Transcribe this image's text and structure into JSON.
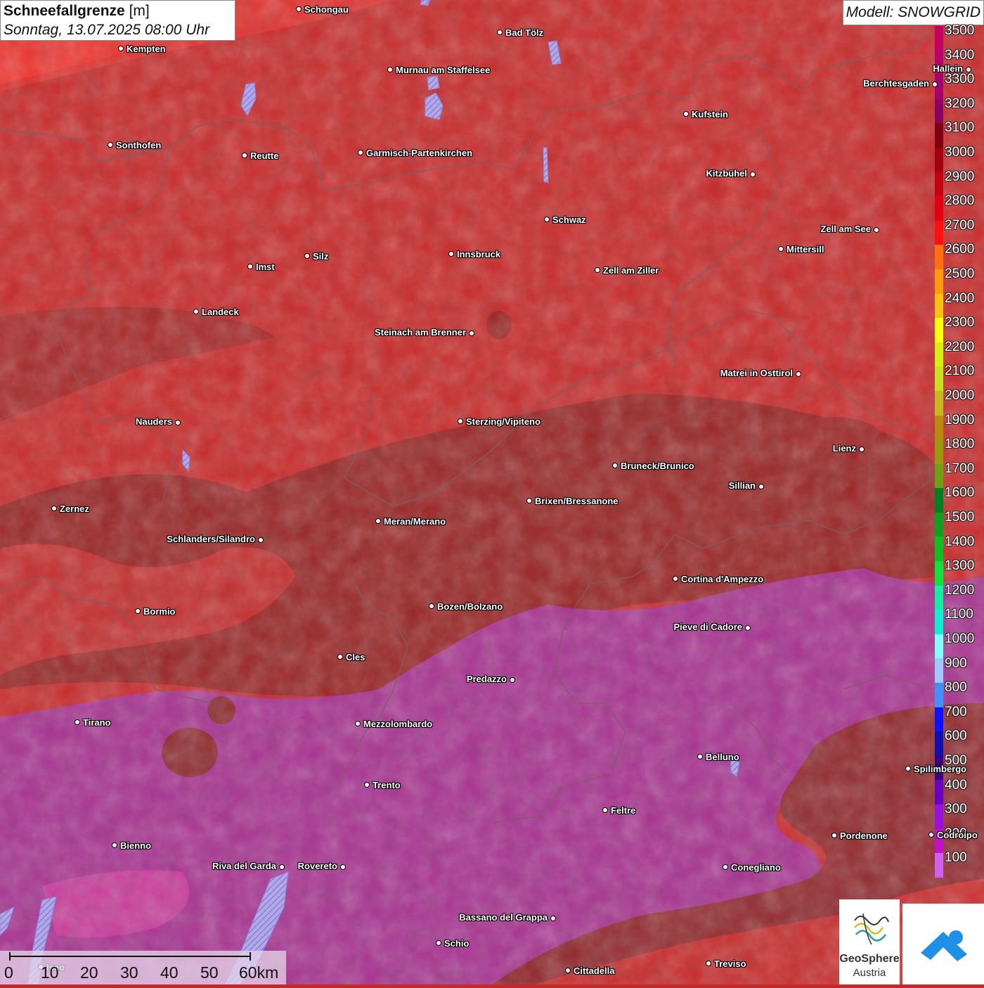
{
  "header": {
    "title_bold": "Schneefallgrenze",
    "title_unit": "[m]",
    "subtitle": "Sonntag, 13.07.2025 08:00 Uhr",
    "model": "Modell: SNOWGRID"
  },
  "legend": {
    "items": [
      {
        "label": "3500",
        "color": "#c4005e"
      },
      {
        "label": "3400",
        "color": "#b8006a"
      },
      {
        "label": "3300",
        "color": "#a3006e"
      },
      {
        "label": "3200",
        "color": "#8a0060"
      },
      {
        "label": "3100",
        "color": "#7a0010"
      },
      {
        "label": "3000",
        "color": "#a00010"
      },
      {
        "label": "2900",
        "color": "#c40010"
      },
      {
        "label": "2800",
        "color": "#e00010"
      },
      {
        "label": "2700",
        "color": "#ff1010"
      },
      {
        "label": "2600",
        "color": "#ff7010"
      },
      {
        "label": "2500",
        "color": "#ff9a10"
      },
      {
        "label": "2400",
        "color": "#ffc010"
      },
      {
        "label": "2300",
        "color": "#ffff10"
      },
      {
        "label": "2200",
        "color": "#d4f010"
      },
      {
        "label": "2100",
        "color": "#c8e020"
      },
      {
        "label": "2000",
        "color": "#c8b820"
      },
      {
        "label": "1900",
        "color": "#b88a10"
      },
      {
        "label": "1800",
        "color": "#9a9a10"
      },
      {
        "label": "1700",
        "color": "#70a010"
      },
      {
        "label": "1600",
        "color": "#008020"
      },
      {
        "label": "1500",
        "color": "#10a020"
      },
      {
        "label": "1400",
        "color": "#10c020"
      },
      {
        "label": "1300",
        "color": "#10e040"
      },
      {
        "label": "1200",
        "color": "#10f0a0"
      },
      {
        "label": "1100",
        "color": "#10f0d0"
      },
      {
        "label": "1000",
        "color": "#80ffff"
      },
      {
        "label": "900",
        "color": "#a0c8ff"
      },
      {
        "label": "800",
        "color": "#4090ff"
      },
      {
        "label": "700",
        "color": "#1010ff"
      },
      {
        "label": "600",
        "color": "#1010b0"
      },
      {
        "label": "500",
        "color": "#3a0080"
      },
      {
        "label": "400",
        "color": "#6a00c0"
      },
      {
        "label": "300",
        "color": "#9a10e0"
      },
      {
        "label": "200",
        "color": "#c010d0"
      },
      {
        "label": "100",
        "color": "#d060f0"
      }
    ]
  },
  "cities": [
    {
      "name": "Schongau",
      "side": "r"
    },
    {
      "name": "Bad Tölz",
      "side": "r"
    },
    {
      "name": "Kempten",
      "side": "r"
    },
    {
      "name": "Murnau am Staffelsee",
      "side": "r"
    },
    {
      "name": "Berchtesgaden",
      "side": "l"
    },
    {
      "name": "Kufstein",
      "side": "r"
    },
    {
      "name": "Sonthofen",
      "side": "r"
    },
    {
      "name": "Reutte",
      "side": "r"
    },
    {
      "name": "Garmisch-Partenkirchen",
      "side": "r"
    },
    {
      "name": "Kitzbühel",
      "side": "l"
    },
    {
      "name": "Schwaz",
      "side": "r"
    },
    {
      "name": "Zell am See",
      "side": "l"
    },
    {
      "name": "Mittersill",
      "side": "r"
    },
    {
      "name": "Innsbruck",
      "side": "r"
    },
    {
      "name": "Silz",
      "side": "r"
    },
    {
      "name": "Imst",
      "side": "r"
    },
    {
      "name": "Zell am Ziller",
      "side": "r"
    },
    {
      "name": "Landeck",
      "side": "r"
    },
    {
      "name": "Steinach am Brenner",
      "side": "l"
    },
    {
      "name": "Matrei in Osttirol",
      "side": "l"
    },
    {
      "name": "Nauders",
      "side": "l"
    },
    {
      "name": "Sterzing/Vipiteno",
      "side": "r"
    },
    {
      "name": "Lienz",
      "side": "l"
    },
    {
      "name": "Bruneck/Brunico",
      "side": "r"
    },
    {
      "name": "Sillian",
      "side": "l"
    },
    {
      "name": "Zernez",
      "side": "r"
    },
    {
      "name": "Brixen/Bressanone",
      "side": "r"
    },
    {
      "name": "Meran/Merano",
      "side": "r"
    },
    {
      "name": "Schlanders/Silandro",
      "side": "l"
    },
    {
      "name": "Cortina d'Ampezzo",
      "side": "r"
    },
    {
      "name": "Bormio",
      "side": "r"
    },
    {
      "name": "Bozen/Bolzano",
      "side": "r"
    },
    {
      "name": "Pieve di Cadore",
      "side": "l"
    },
    {
      "name": "Cles",
      "side": "r"
    },
    {
      "name": "Predazzo",
      "side": "l"
    },
    {
      "name": "Tirano",
      "side": "r"
    },
    {
      "name": "Mezzolombardo",
      "side": "r"
    },
    {
      "name": "Belluno",
      "side": "r"
    },
    {
      "name": "Spilimbergo",
      "side": "r"
    },
    {
      "name": "Trento",
      "side": "r"
    },
    {
      "name": "Feltre",
      "side": "r"
    },
    {
      "name": "Pordenone",
      "side": "r"
    },
    {
      "name": "Bienno",
      "side": "r"
    },
    {
      "name": "Riva del Garda",
      "side": "l"
    },
    {
      "name": "Rovereto",
      "side": "l"
    },
    {
      "name": "Conegliano",
      "side": "r"
    },
    {
      "name": "Bassano del Grappa",
      "side": "l"
    },
    {
      "name": "Schio",
      "side": "r"
    },
    {
      "name": "Treviso",
      "side": "r"
    },
    {
      "name": "Cittadella",
      "side": "r"
    },
    {
      "name": "Hallein",
      "side": "l"
    },
    {
      "name": "Codroipo",
      "side": "r"
    },
    {
      "name": "Iseo",
      "side": "r"
    }
  ],
  "scale": {
    "labels": [
      "0",
      "10",
      "20",
      "30",
      "40",
      "50",
      "60km"
    ]
  },
  "logos": {
    "geosphere_line1": "GeoSphere",
    "geosphere_line2": "Austria"
  }
}
